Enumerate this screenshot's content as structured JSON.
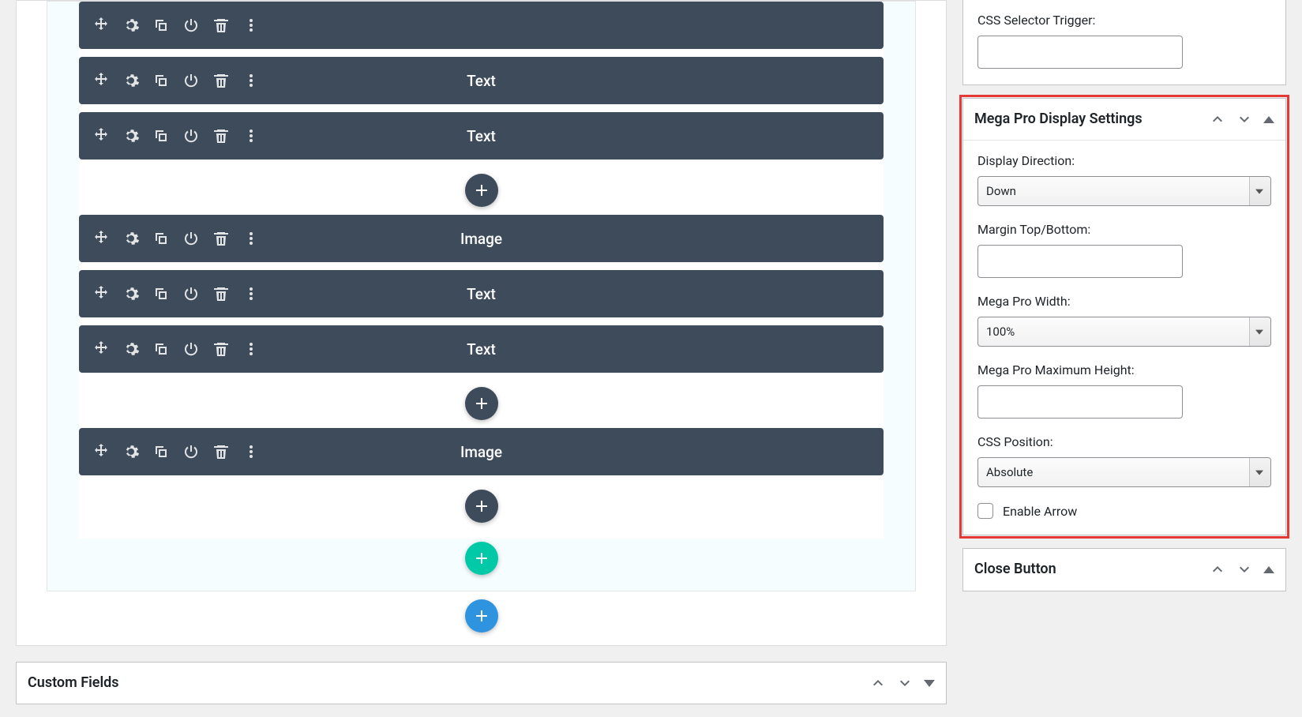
{
  "builder": {
    "groups": [
      {
        "modules": [
          "",
          "Text",
          "Text"
        ]
      },
      {
        "modules": [
          "Image",
          "Text",
          "Text"
        ]
      },
      {
        "modules": [
          "Image"
        ]
      }
    ]
  },
  "sidebar": {
    "css_selector_trigger": {
      "label": "CSS Selector Trigger:",
      "value": ""
    },
    "mega_display": {
      "title": "Mega Pro Display Settings",
      "display_direction": {
        "label": "Display Direction:",
        "value": "Down"
      },
      "margin": {
        "label": "Margin Top/Bottom:",
        "value": ""
      },
      "width": {
        "label": "Mega Pro Width:",
        "value": "100%"
      },
      "max_height": {
        "label": "Mega Pro Maximum Height:",
        "value": ""
      },
      "css_position": {
        "label": "CSS Position:",
        "value": "Absolute"
      },
      "enable_arrow": {
        "label": "Enable Arrow",
        "checked": false
      }
    },
    "close_button": {
      "title": "Close Button"
    }
  },
  "custom_fields": {
    "title": "Custom Fields"
  }
}
